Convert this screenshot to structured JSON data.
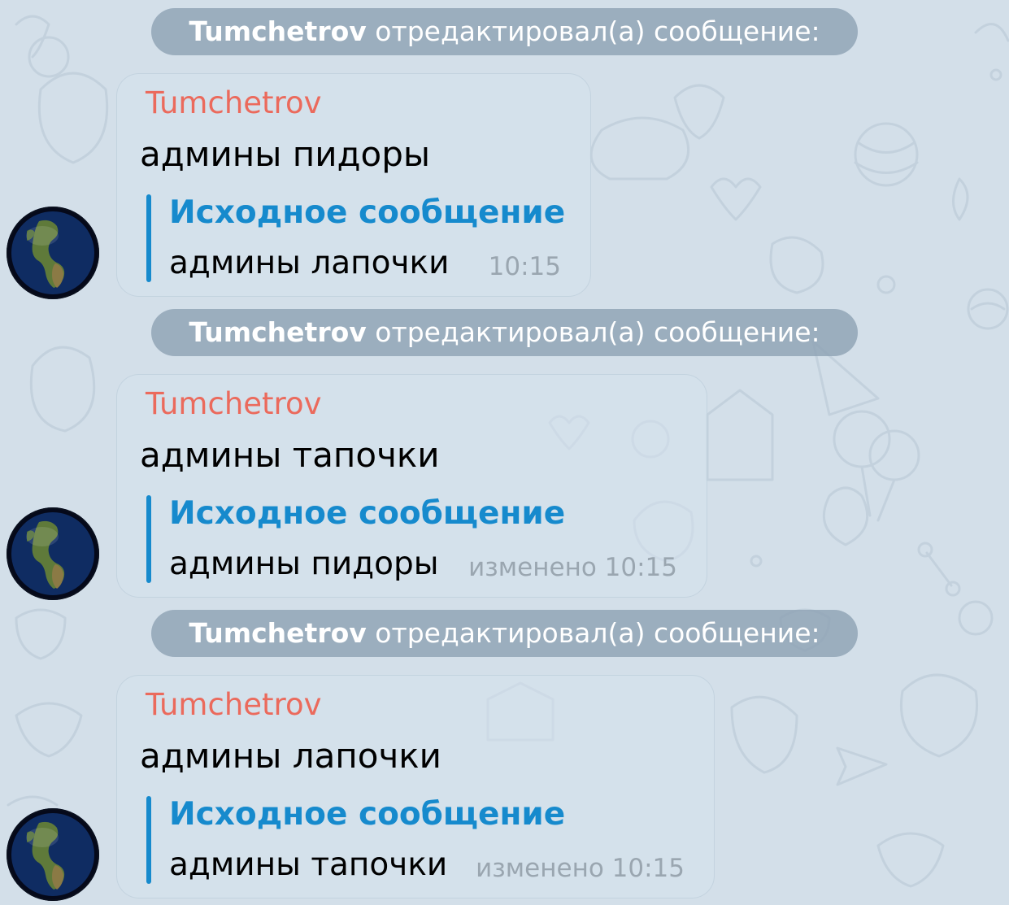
{
  "events": [
    {
      "service": {
        "author": "Tumchetrov",
        "action": "отредактировал(а) сообщение:"
      },
      "message": {
        "sender": "Tumchetrov",
        "text": "админы пидоры",
        "quote_title": "Исходное сообщение",
        "quote_text": "админы лапочки",
        "meta": "10:15"
      },
      "avatar_icon": "earth-globe-avatar"
    },
    {
      "service": {
        "author": "Tumchetrov",
        "action": "отредактировал(а) сообщение:"
      },
      "message": {
        "sender": "Tumchetrov",
        "text": "админы тапочки",
        "quote_title": "Исходное сообщение",
        "quote_text": "админы пидоры",
        "meta": "изменено 10:15"
      },
      "avatar_icon": "earth-globe-avatar"
    },
    {
      "service": {
        "author": "Tumchetrov",
        "action": "отредактировал(а) сообщение:"
      },
      "message": {
        "sender": "Tumchetrov",
        "text": "админы лапочки",
        "quote_title": "Исходное сообщение",
        "quote_text": "админы тапочки",
        "meta": "изменено 10:15"
      },
      "avatar_icon": "earth-globe-avatar"
    }
  ],
  "colors": {
    "background": "#d3dfe9",
    "sender_name": "#eb6a5c",
    "quote_accent": "#168acd",
    "service_pill": "#8ca0b2",
    "meta_text": "#9aa6b0"
  }
}
